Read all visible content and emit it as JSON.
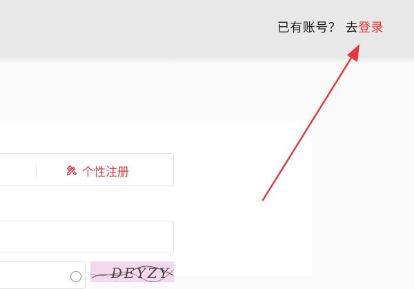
{
  "header": {
    "prompt_text": "已有账号？ 去",
    "login_link": "登录"
  },
  "register": {
    "tab_personal": "个性注册",
    "tab_icon": "pencil-ruler-icon",
    "accent_color": "#e8383d"
  },
  "form": {
    "input_value": "",
    "captcha_text": "DEYZY"
  },
  "annotation": {
    "arrow_color": "#e8383d"
  }
}
